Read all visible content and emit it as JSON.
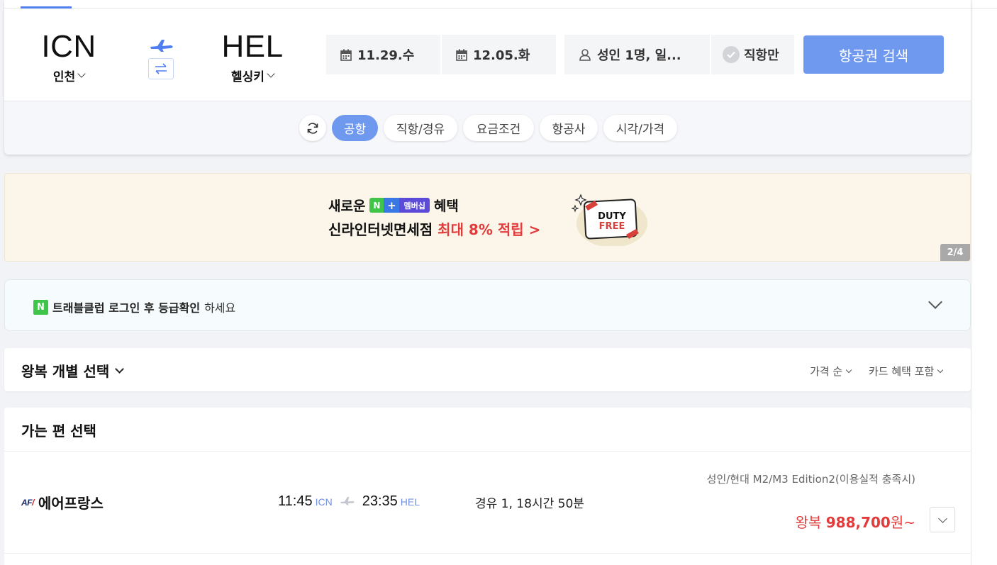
{
  "search": {
    "origin": {
      "code": "ICN",
      "city": "인천"
    },
    "destination": {
      "code": "HEL",
      "city": "헬싱키"
    },
    "depart_date": "11.29.수",
    "return_date": "12.05.화",
    "passengers": "성인 1명, 일...",
    "direct_only": "직항만",
    "search_button": "항공권 검색"
  },
  "filters": [
    "공항",
    "직항/경유",
    "요금조건",
    "항공사",
    "시각/가격"
  ],
  "banner": {
    "prefix": "새로운",
    "badge_n": "N",
    "badge_plus": "+",
    "badge_member": "멤버십",
    "suffix": "혜택",
    "line2_main": "신라인터넷면세점",
    "line2_accent": "최대 8% 적립 >",
    "illustration_line1": "DUTY",
    "illustration_line2": "FREE",
    "page": "2/4"
  },
  "club": {
    "logo": "N",
    "bold_text": "트래블클럽 로그인 후 등급확인",
    "rest_text": "하세요"
  },
  "selection": {
    "mode_title": "왕복 개별 선택",
    "sort_price": "가격 순",
    "sort_card": "카드 혜택 포함"
  },
  "outbound": {
    "title": "가는 편 선택",
    "flights": [
      {
        "airline_logo_a": "AF",
        "airline_logo_b": "/",
        "airline": "에어프랑스",
        "depart_time": "11:45",
        "depart_airport": "ICN",
        "arrive_time": "23:35",
        "arrive_airport": "HEL",
        "stops_duration": "경유 1, 18시간 50분",
        "card_note": "성인/현대 M2/M3 Edition2(이용실적 충족시)",
        "price_prefix": "왕복",
        "price_amount": "988,700",
        "price_suffix": "원~"
      }
    ]
  },
  "colors": {
    "accent": "#6f98ef",
    "price": "#e23b3b",
    "naver_green": "#3fc54a"
  }
}
